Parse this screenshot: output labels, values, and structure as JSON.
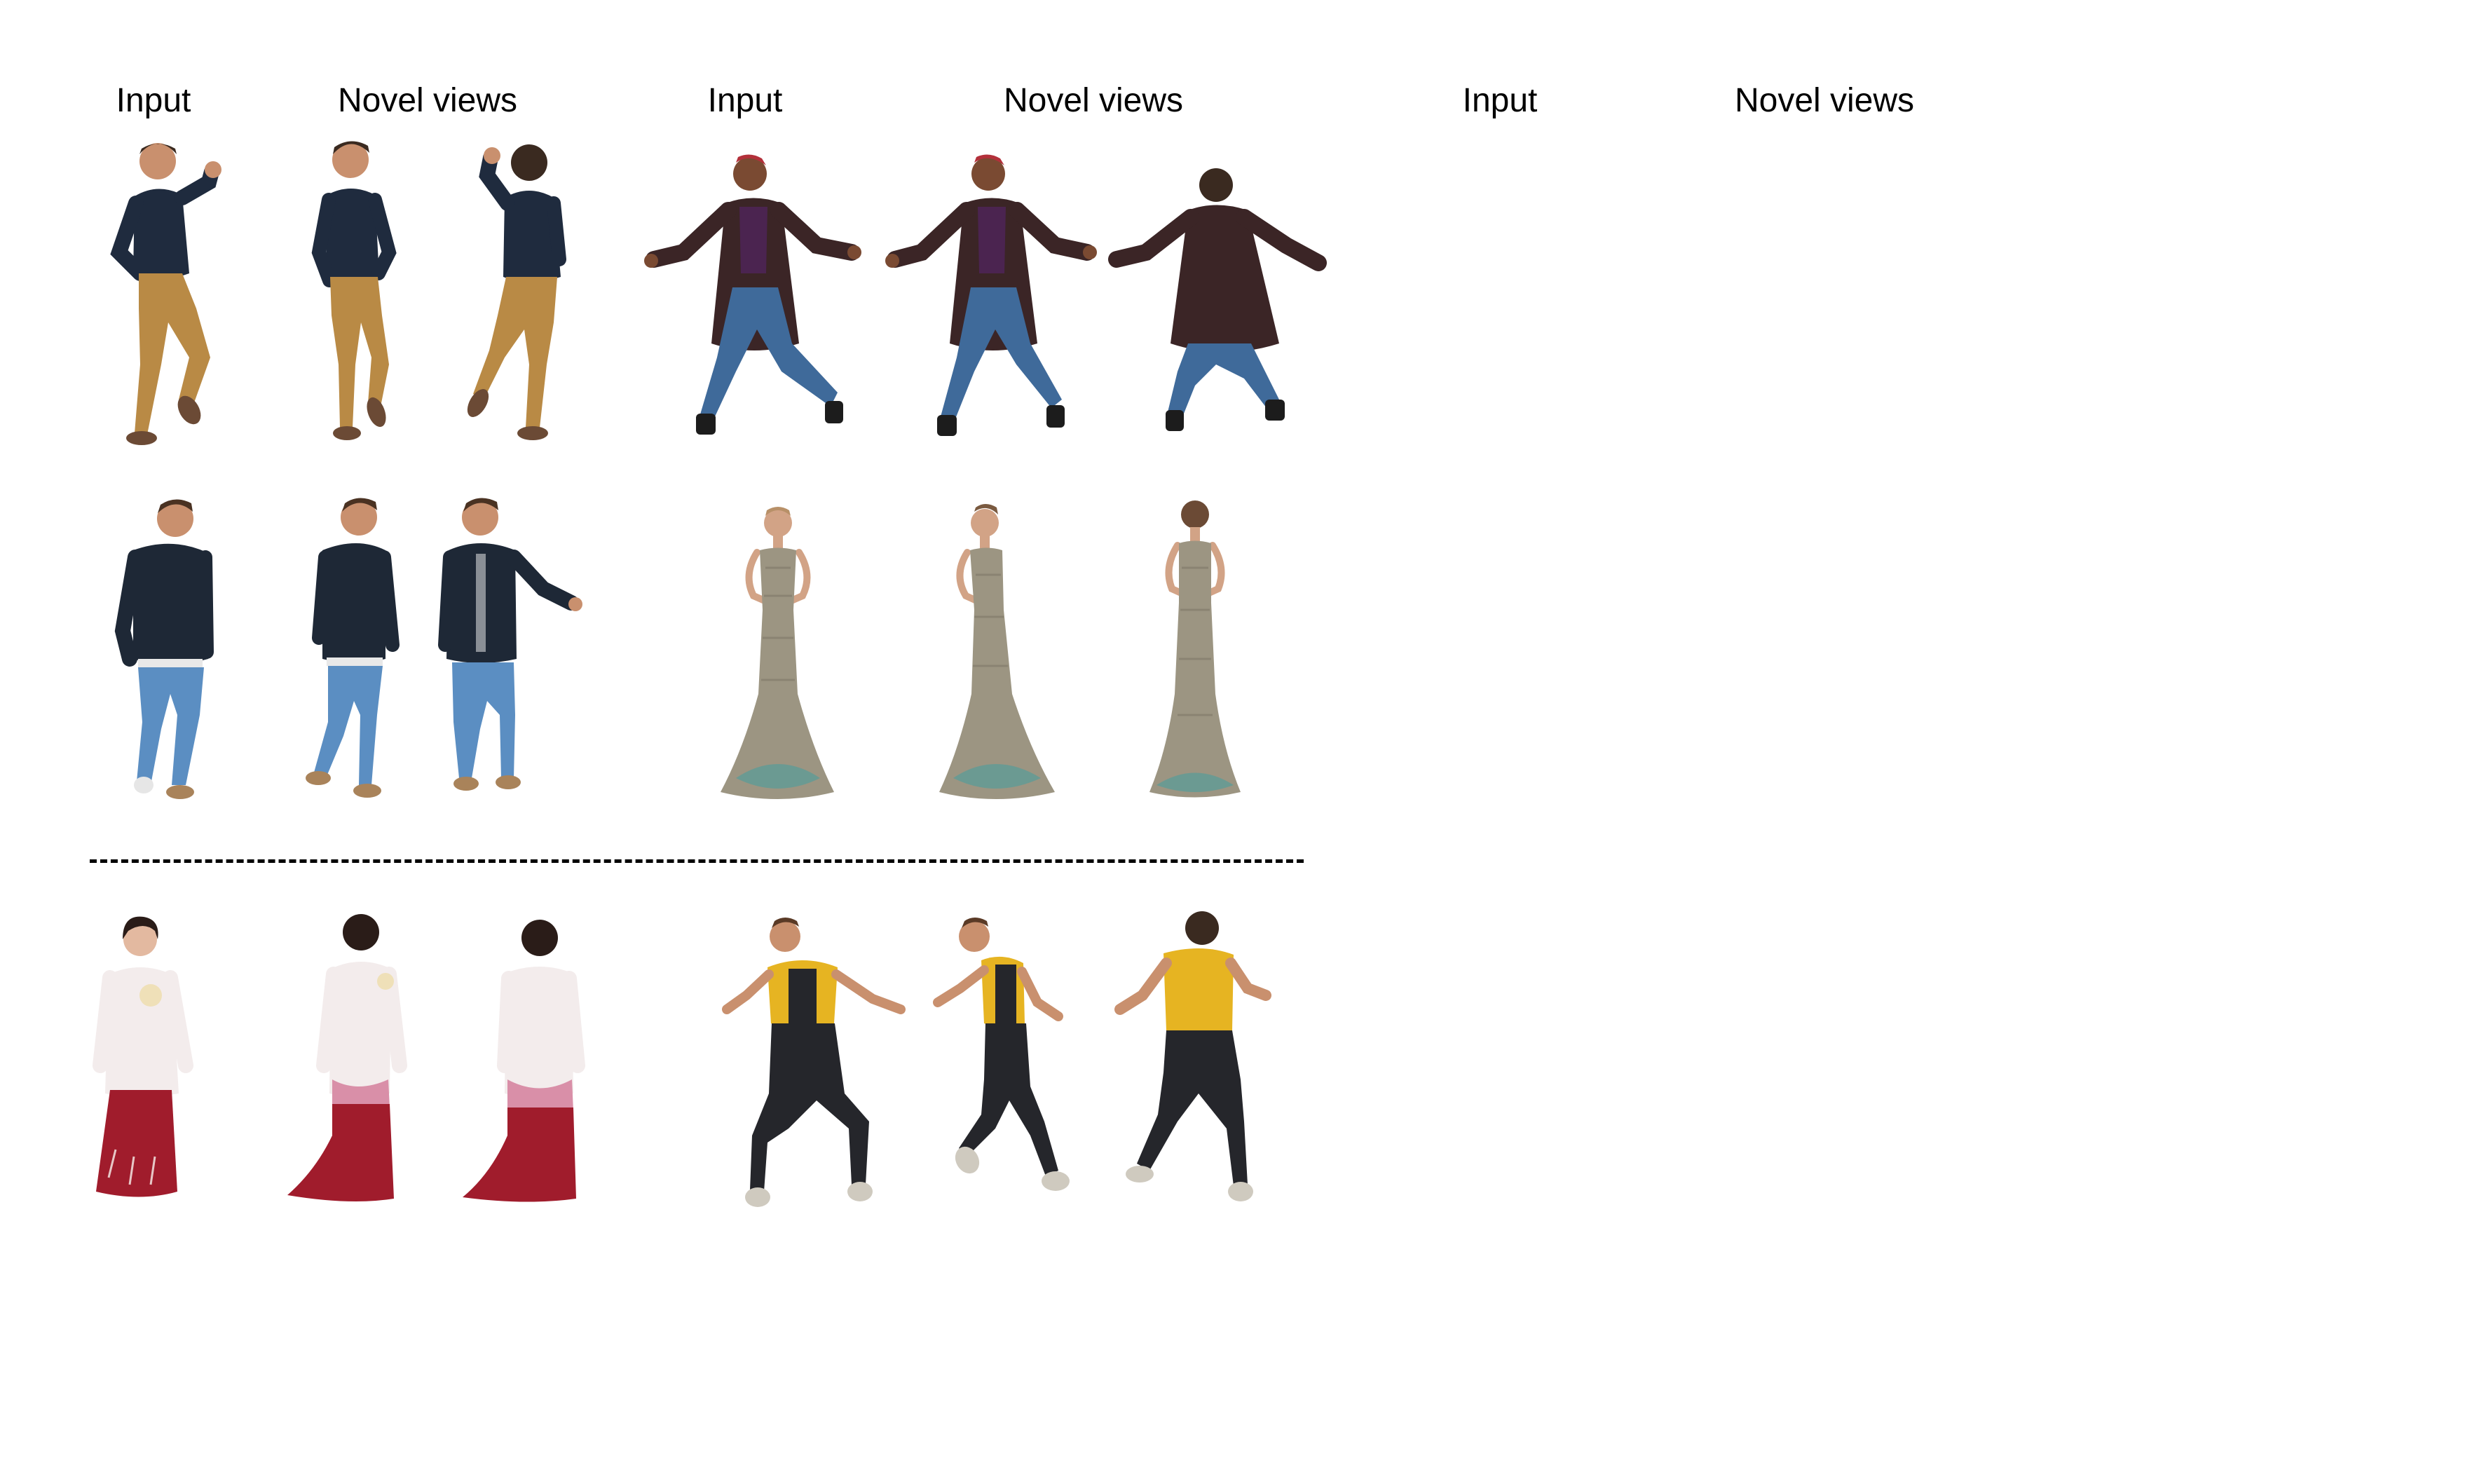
{
  "column_labels": {
    "input_1": "Input",
    "novel_1": "Novel views",
    "input_2": "Input",
    "novel_2": "Novel views",
    "input_3": "Input",
    "novel_3": "Novel views"
  },
  "palette": {
    "skin": "#c9906e",
    "hair": "#3a2a20",
    "navy_sweater": "#1f2b3e",
    "khaki_pants": "#b98a45",
    "brown_shoes": "#6b4a35",
    "coat": "#3b2526",
    "purple_shirt": "#4b2450",
    "denim": "#3f6a9a",
    "black_boots": "#1c1c1c",
    "dark_jacket": "#1e2836",
    "light_denim": "#5b8ec2",
    "tan_boots": "#a9835a",
    "gown": "#9c9582",
    "gown_sequin": "#6b9a92",
    "white_robe": "#f3ecec",
    "red_skirt": "#a01c2c",
    "yellow_shirt": "#e6b422",
    "black_overalls": "#25262b",
    "sneakers": "#cfcabf"
  }
}
